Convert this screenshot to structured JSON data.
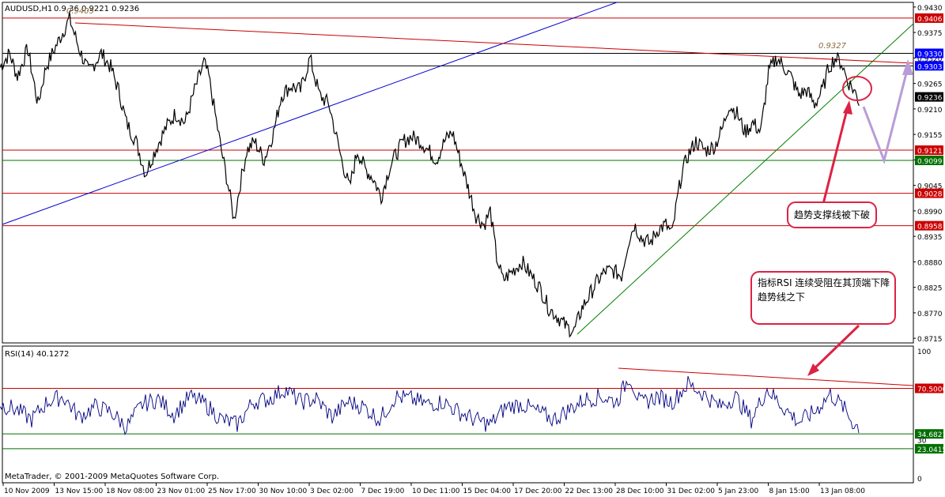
{
  "symbol_header": {
    "symbol": "AUDUSD,H1",
    "ohlc_text": "0.9  36 0.9221 0.9236",
    "high_mark": "0.9405"
  },
  "peak_label": "0.9327",
  "copyright": "MetaTrader, © 2001-2009 MetaQuotes Software Corp.",
  "rsi_header": "RSI(14) 40.1272",
  "annotations": {
    "support_break": "趋势支撑线被下破",
    "rsi_line1": "指标RSI 连续受阻在其顶端下降",
    "rsi_line2": "趋势线之下"
  },
  "colors": {
    "grid_line": "#000000",
    "price_bar": "#000000",
    "resistance": "#cc0000",
    "support": "#007000",
    "trend_blue": "#0000cc",
    "trend_green": "#008000",
    "rsi_line": "#000080",
    "arrow_red": "#dd2244",
    "projection": "#b89cd8",
    "current_tag": "#000000",
    "blue_tag": "#0000ff"
  },
  "chart_data": [
    {
      "type": "line",
      "title": "AUDUSD,H1",
      "y_axis_ticks": [
        "0.9430",
        "0.9375",
        "0.9320",
        "0.9265",
        "0.9210",
        "0.9155",
        "0.9100",
        "0.9045",
        "0.8990",
        "0.8935",
        "0.8880",
        "0.8825",
        "0.8770",
        "0.8715"
      ],
      "x_axis_labels": [
        "10 Nov 2009",
        "13 Nov 15:00",
        "18 Nov 08:00",
        "23 Nov 01:00",
        "25 Nov 17:00",
        "30 Nov 10:00",
        "3 Dec 02:00",
        "7 Dec 19:00",
        "10 Dec 11:00",
        "15 Dec 04:00",
        "17 Dec 20:00",
        "22 Dec 13:00",
        "28 Dec 10:00",
        "31 Dec 02:00",
        "5 Jan 23:00",
        "8 Jan 15:00",
        "13 Jan 08:00"
      ],
      "ylim": [
        0.8705,
        0.944
      ],
      "current_price": "0.9236",
      "horizontal_levels": [
        {
          "value": 0.9406,
          "label": "0.9406",
          "color": "#cc0000"
        },
        {
          "value": 0.933,
          "label": "0.9330",
          "color": "#0000ff"
        },
        {
          "value": 0.9303,
          "label": "0.9303",
          "color": "#0000ff"
        },
        {
          "value": 0.9121,
          "label": "0.9121",
          "color": "#cc0000"
        },
        {
          "value": 0.9099,
          "label": "0.9099",
          "color": "#007000"
        },
        {
          "value": 0.9028,
          "label": "0.9028",
          "color": "#cc0000"
        },
        {
          "value": 0.8958,
          "label": "0.8958",
          "color": "#cc0000"
        }
      ],
      "price_path": [
        [
          0,
          0.93
        ],
        [
          12,
          0.933
        ],
        [
          22,
          0.928
        ],
        [
          35,
          0.934
        ],
        [
          48,
          0.922
        ],
        [
          58,
          0.93
        ],
        [
          72,
          0.935
        ],
        [
          88,
          0.9405
        ],
        [
          100,
          0.934
        ],
        [
          112,
          0.929
        ],
        [
          128,
          0.933
        ],
        [
          140,
          0.93
        ],
        [
          150,
          0.925
        ],
        [
          160,
          0.918
        ],
        [
          172,
          0.914
        ],
        [
          184,
          0.907
        ],
        [
          196,
          0.912
        ],
        [
          210,
          0.917
        ],
        [
          222,
          0.92
        ],
        [
          234,
          0.918
        ],
        [
          246,
          0.925
        ],
        [
          258,
          0.931
        ],
        [
          264,
          0.928
        ],
        [
          272,
          0.92
        ],
        [
          280,
          0.912
        ],
        [
          288,
          0.905
        ],
        [
          296,
          0.897
        ],
        [
          304,
          0.905
        ],
        [
          312,
          0.912
        ],
        [
          322,
          0.914
        ],
        [
          334,
          0.91
        ],
        [
          346,
          0.916
        ],
        [
          356,
          0.924
        ],
        [
          368,
          0.926
        ],
        [
          380,
          0.925
        ],
        [
          392,
          0.932
        ],
        [
          404,
          0.924
        ],
        [
          416,
          0.922
        ],
        [
          424,
          0.916
        ],
        [
          432,
          0.91
        ],
        [
          442,
          0.904
        ],
        [
          452,
          0.912
        ],
        [
          462,
          0.908
        ],
        [
          472,
          0.906
        ],
        [
          482,
          0.902
        ],
        [
          492,
          0.908
        ],
        [
          500,
          0.911
        ],
        [
          510,
          0.914
        ],
        [
          520,
          0.915
        ],
        [
          532,
          0.914
        ],
        [
          542,
          0.912
        ],
        [
          552,
          0.91
        ],
        [
          562,
          0.914
        ],
        [
          572,
          0.916
        ],
        [
          582,
          0.91
        ],
        [
          592,
          0.904
        ],
        [
          602,
          0.898
        ],
        [
          612,
          0.896
        ],
        [
          620,
          0.899
        ],
        [
          628,
          0.889
        ],
        [
          636,
          0.884
        ],
        [
          648,
          0.886
        ],
        [
          660,
          0.888
        ],
        [
          672,
          0.885
        ],
        [
          684,
          0.882
        ],
        [
          694,
          0.878
        ],
        [
          706,
          0.876
        ],
        [
          716,
          0.874
        ],
        [
          726,
          0.873
        ],
        [
          736,
          0.878
        ],
        [
          746,
          0.881
        ],
        [
          756,
          0.884
        ],
        [
          766,
          0.886
        ],
        [
          776,
          0.886
        ],
        [
          786,
          0.885
        ],
        [
          794,
          0.892
        ],
        [
          802,
          0.896
        ],
        [
          812,
          0.893
        ],
        [
          822,
          0.892
        ],
        [
          832,
          0.895
        ],
        [
          842,
          0.896
        ],
        [
          850,
          0.894
        ],
        [
          856,
          0.901
        ],
        [
          862,
          0.907
        ],
        [
          870,
          0.911
        ],
        [
          880,
          0.914
        ],
        [
          892,
          0.912
        ],
        [
          904,
          0.913
        ],
        [
          914,
          0.917
        ],
        [
          922,
          0.922
        ],
        [
          932,
          0.92
        ],
        [
          942,
          0.916
        ],
        [
          952,
          0.918
        ],
        [
          962,
          0.916
        ],
        [
          972,
          0.929
        ],
        [
          982,
          0.932
        ],
        [
          992,
          0.93
        ],
        [
          1000,
          0.928
        ],
        [
          1010,
          0.924
        ],
        [
          1020,
          0.925
        ],
        [
          1030,
          0.922
        ],
        [
          1040,
          0.925
        ],
        [
          1048,
          0.93
        ],
        [
          1056,
          0.932
        ],
        [
          1064,
          0.931
        ],
        [
          1072,
          0.927
        ],
        [
          1080,
          0.925
        ],
        [
          1088,
          0.922
        ]
      ]
    },
    {
      "type": "line",
      "title": "RSI(14) 40.1272",
      "y_axis_ticks": [
        "100",
        "70.5000",
        "34.6821",
        "30",
        "23.0415",
        "0"
      ],
      "levels": [
        70.5,
        34.6821,
        23.0415
      ],
      "ylim": [
        0,
        100
      ],
      "rsi_path": [
        [
          0,
          58
        ],
        [
          20,
          54
        ],
        [
          40,
          46
        ],
        [
          60,
          60
        ],
        [
          80,
          64
        ],
        [
          100,
          48
        ],
        [
          120,
          56
        ],
        [
          140,
          52
        ],
        [
          160,
          40
        ],
        [
          180,
          58
        ],
        [
          200,
          62
        ],
        [
          220,
          50
        ],
        [
          240,
          64
        ],
        [
          260,
          58
        ],
        [
          280,
          46
        ],
        [
          300,
          42
        ],
        [
          320,
          60
        ],
        [
          340,
          62
        ],
        [
          360,
          70
        ],
        [
          380,
          60
        ],
        [
          400,
          62
        ],
        [
          420,
          48
        ],
        [
          440,
          60
        ],
        [
          460,
          56
        ],
        [
          480,
          46
        ],
        [
          500,
          64
        ],
        [
          520,
          62
        ],
        [
          540,
          58
        ],
        [
          560,
          60
        ],
        [
          580,
          52
        ],
        [
          600,
          46
        ],
        [
          620,
          42
        ],
        [
          640,
          56
        ],
        [
          660,
          58
        ],
        [
          680,
          52
        ],
        [
          700,
          46
        ],
        [
          720,
          54
        ],
        [
          740,
          62
        ],
        [
          760,
          64
        ],
        [
          780,
          60
        ],
        [
          796,
          80
        ],
        [
          810,
          58
        ],
        [
          830,
          64
        ],
        [
          850,
          60
        ],
        [
          870,
          74
        ],
        [
          890,
          66
        ],
        [
          910,
          56
        ],
        [
          930,
          64
        ],
        [
          950,
          46
        ],
        [
          970,
          70
        ],
        [
          990,
          56
        ],
        [
          1010,
          44
        ],
        [
          1030,
          52
        ],
        [
          1050,
          66
        ],
        [
          1066,
          56
        ],
        [
          1080,
          42
        ],
        [
          1088,
          40
        ]
      ]
    }
  ]
}
